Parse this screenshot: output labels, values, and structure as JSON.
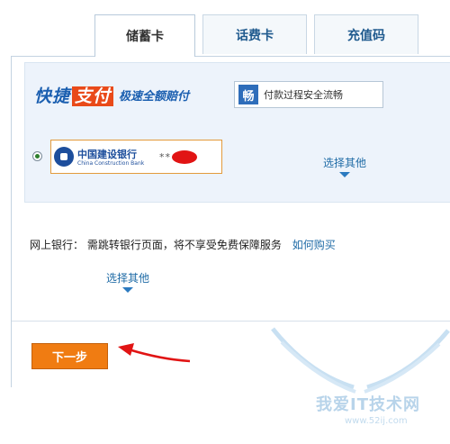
{
  "tabs": [
    {
      "label": "储蓄卡",
      "active": true
    },
    {
      "label": "话费卡",
      "active": false
    },
    {
      "label": "充值码",
      "active": false
    }
  ],
  "quickpay": {
    "title_part1": "快捷",
    "title_highlight": "支付",
    "subtitle": "极速全额赔付",
    "safe_icon_glyph": "畅",
    "safe_text": "付款过程安全流畅"
  },
  "bank": {
    "name_cn": "中国建设银行",
    "name_en": "China Construction Bank",
    "card_number": "**",
    "selected": true
  },
  "more_label_1": "选择其他",
  "online_bank": {
    "label": "网上银行：",
    "desc": "需跳转银行页面，将不享受免费保障服务",
    "link": "如何购买"
  },
  "more_label_2": "选择其他",
  "next_button": "下一步",
  "watermark": {
    "text": "我爱IT技术网",
    "url": "www.52ij.com"
  },
  "colors": {
    "accent_orange": "#f07c12",
    "link_blue": "#1f6ba6",
    "panel_bg": "#edf3fb",
    "arrow_red": "#e11414"
  }
}
